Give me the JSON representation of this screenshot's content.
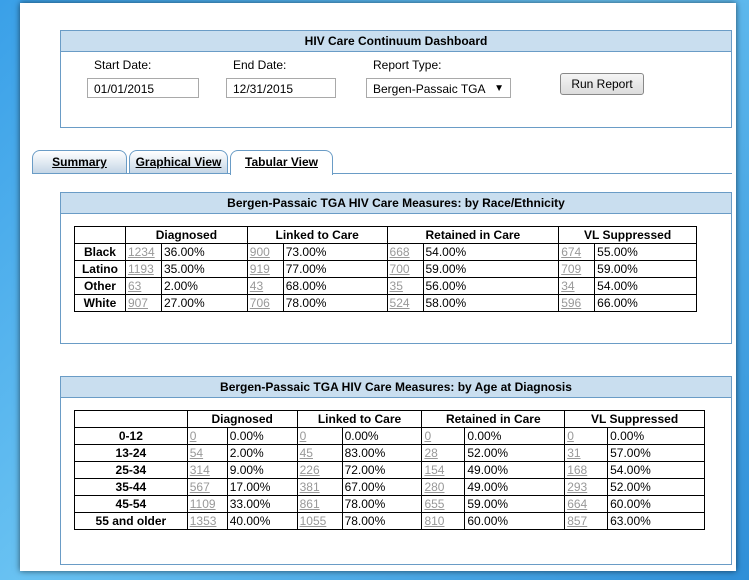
{
  "header": {
    "title": "HIV Care Continuum Dashboard",
    "start_label": "Start Date:",
    "start_value": "01/01/2015",
    "end_label": "End Date:",
    "end_value": "12/31/2015",
    "report_label": "Report Type:",
    "report_value": "Bergen-Passaic TGA",
    "run_label": "Run Report"
  },
  "tabs": [
    {
      "label": "Summary"
    },
    {
      "label": "Graphical View"
    },
    {
      "label": "Tabular View"
    }
  ],
  "race_table": {
    "title": "Bergen-Passaic TGA HIV Care Measures: by Race/Ethnicity",
    "columns": [
      "Diagnosed",
      "Linked to Care",
      "Retained in Care",
      "VL Suppressed"
    ],
    "rows": [
      {
        "label": "Black",
        "d": "1234",
        "dp": "36.00%",
        "l": "900",
        "lp": "73.00%",
        "r": "668",
        "rp": "54.00%",
        "v": "674",
        "vp": "55.00%"
      },
      {
        "label": "Latino",
        "d": "1193",
        "dp": "35.00%",
        "l": "919",
        "lp": "77.00%",
        "r": "700",
        "rp": "59.00%",
        "v": "709",
        "vp": "59.00%"
      },
      {
        "label": "Other",
        "d": "63",
        "dp": "2.00%",
        "l": "43",
        "lp": "68.00%",
        "r": "35",
        "rp": "56.00%",
        "v": "34",
        "vp": "54.00%"
      },
      {
        "label": "White",
        "d": "907",
        "dp": "27.00%",
        "l": "706",
        "lp": "78.00%",
        "r": "524",
        "rp": "58.00%",
        "v": "596",
        "vp": "66.00%"
      }
    ]
  },
  "age_table": {
    "title": "Bergen-Passaic TGA HIV Care Measures: by Age at Diagnosis",
    "columns": [
      "Diagnosed",
      "Linked to Care",
      "Retained in Care",
      "VL Suppressed"
    ],
    "rows": [
      {
        "label": "0-12",
        "d": "0",
        "dp": "0.00%",
        "l": "0",
        "lp": "0.00%",
        "r": "0",
        "rp": "0.00%",
        "v": "0",
        "vp": "0.00%"
      },
      {
        "label": "13-24",
        "d": "54",
        "dp": "2.00%",
        "l": "45",
        "lp": "83.00%",
        "r": "28",
        "rp": "52.00%",
        "v": "31",
        "vp": "57.00%"
      },
      {
        "label": "25-34",
        "d": "314",
        "dp": "9.00%",
        "l": "226",
        "lp": "72.00%",
        "r": "154",
        "rp": "49.00%",
        "v": "168",
        "vp": "54.00%"
      },
      {
        "label": "35-44",
        "d": "567",
        "dp": "17.00%",
        "l": "381",
        "lp": "67.00%",
        "r": "280",
        "rp": "49.00%",
        "v": "293",
        "vp": "52.00%"
      },
      {
        "label": "45-54",
        "d": "1109",
        "dp": "33.00%",
        "l": "861",
        "lp": "78.00%",
        "r": "655",
        "rp": "59.00%",
        "v": "664",
        "vp": "60.00%"
      },
      {
        "label": "55 and older",
        "d": "1353",
        "dp": "40.00%",
        "l": "1055",
        "lp": "78.00%",
        "r": "810",
        "rp": "60.00%",
        "v": "857",
        "vp": "63.00%"
      }
    ]
  }
}
